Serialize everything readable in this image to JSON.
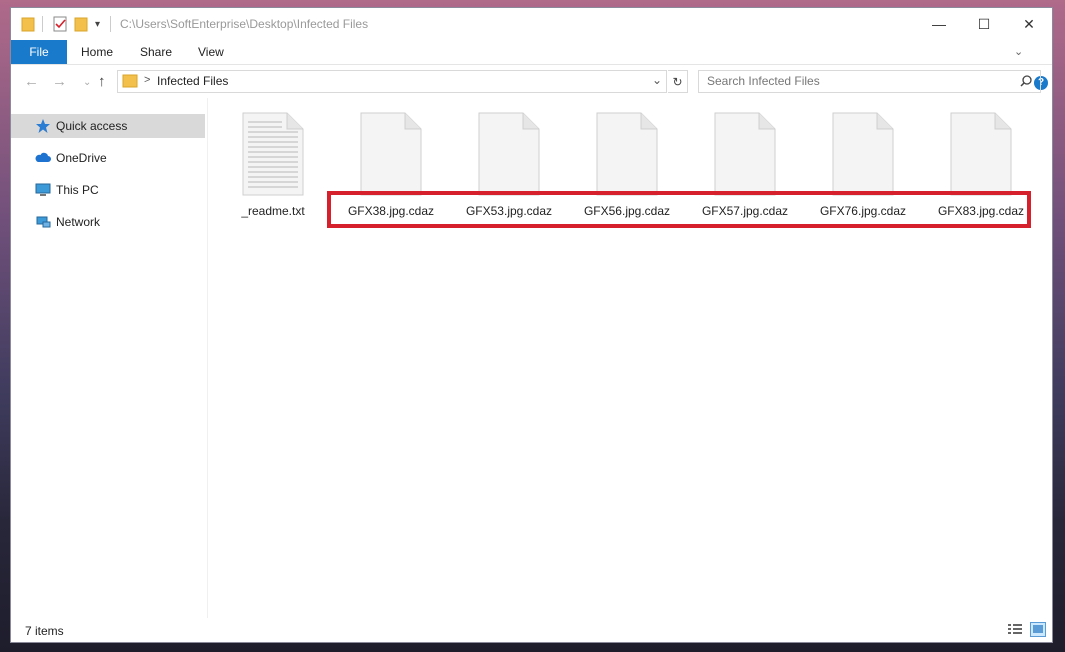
{
  "window": {
    "title": "C:\\Users\\SoftEnterprise\\Desktop\\Infected Files",
    "controls": {
      "minimize": "—",
      "maximize": "☐",
      "close": "✕"
    }
  },
  "ribbon": {
    "tabs": [
      "File",
      "Home",
      "Share",
      "View"
    ],
    "expand_icon": "chevron-down-icon",
    "help_icon": "?"
  },
  "address": {
    "path": "Infected Files",
    "separator": ">",
    "search_placeholder": "Search Infected Files"
  },
  "sidebar": {
    "items": [
      {
        "label": "Quick access",
        "icon": "star-icon",
        "selected": true
      },
      {
        "label": "OneDrive",
        "icon": "cloud-icon",
        "selected": false
      },
      {
        "label": "This PC",
        "icon": "computer-icon",
        "selected": false
      },
      {
        "label": "Network",
        "icon": "network-icon",
        "selected": false
      }
    ]
  },
  "files": [
    {
      "name": "_readme.txt",
      "type": "text"
    },
    {
      "name": "GFX38.jpg.cdaz",
      "type": "blank"
    },
    {
      "name": "GFX53.jpg.cdaz",
      "type": "blank"
    },
    {
      "name": "GFX56.jpg.cdaz",
      "type": "blank"
    },
    {
      "name": "GFX57.jpg.cdaz",
      "type": "blank"
    },
    {
      "name": "GFX76.jpg.cdaz",
      "type": "blank"
    },
    {
      "name": "GFX83.jpg.cdaz",
      "type": "blank"
    }
  ],
  "status": {
    "item_count": "7 items"
  },
  "colors": {
    "accent": "#1979ca",
    "highlight_box": "#d6202b",
    "selected_nav": "#d9d9d9"
  }
}
